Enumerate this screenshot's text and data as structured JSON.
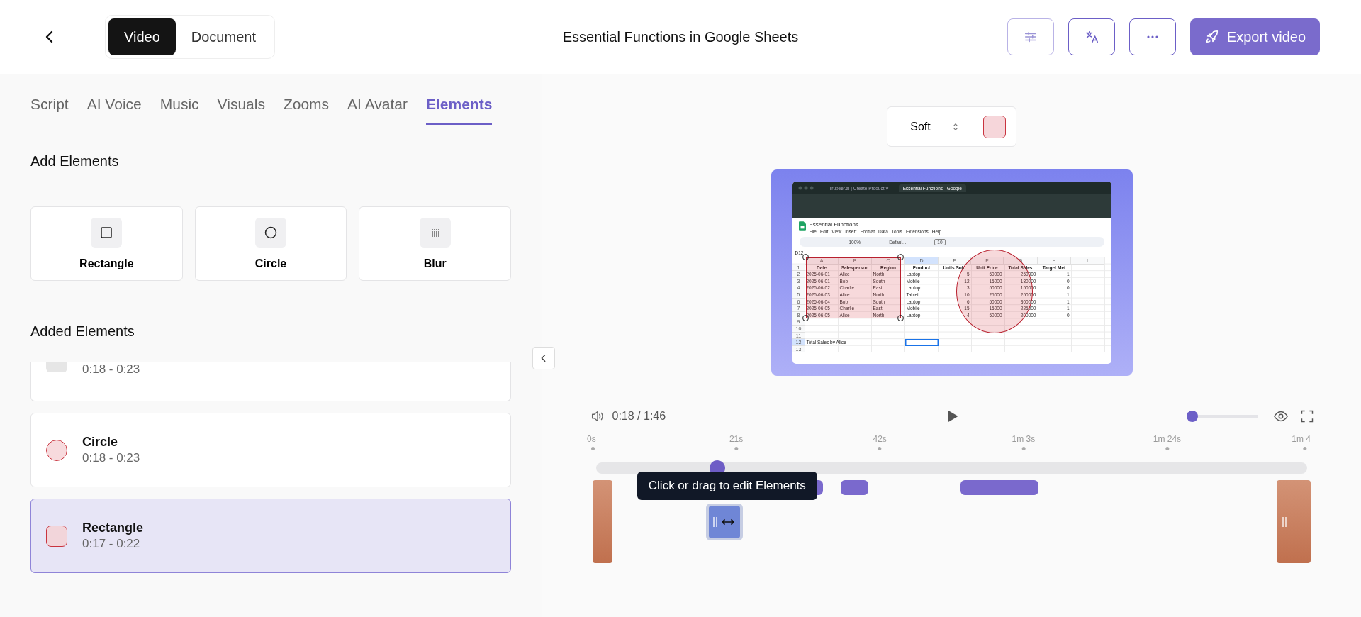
{
  "header": {
    "mode_tabs": [
      {
        "label": "Video",
        "selected": true
      },
      {
        "label": "Document",
        "selected": false
      }
    ],
    "title": "Essential Functions in Google Sheets",
    "export_button": "Export video"
  },
  "panel_tabs": [
    {
      "label": "Script",
      "selected": false
    },
    {
      "label": "AI Voice",
      "selected": false
    },
    {
      "label": "Music",
      "selected": false
    },
    {
      "label": "Visuals",
      "selected": false
    },
    {
      "label": "Zooms",
      "selected": false
    },
    {
      "label": "AI Avatar",
      "selected": false
    },
    {
      "label": "Elements",
      "selected": true
    }
  ],
  "add_elements": {
    "heading": "Add Elements",
    "items": [
      {
        "label": "Rectangle",
        "kind": "rectangle"
      },
      {
        "label": "Circle",
        "kind": "circle"
      },
      {
        "label": "Blur",
        "kind": "blur"
      }
    ]
  },
  "added_elements": {
    "heading": "Added Elements",
    "items": [
      {
        "kind": "blur",
        "time": "0:18 - 0:23",
        "selected": false
      },
      {
        "kind": "circle",
        "name": "Circle",
        "time": "0:18 - 0:23",
        "selected": false
      },
      {
        "kind": "rectangle",
        "name": "Rectangle",
        "time": "0:17 - 0:22",
        "selected": true
      }
    ]
  },
  "style_picker": {
    "value": "Soft"
  },
  "preview": {
    "browser_tabs": [
      {
        "title": "Trupeer.ai | Create Product V",
        "selected": false
      },
      {
        "title": "Essential Functions - Google",
        "selected": true
      }
    ],
    "doc_title": "Essential Functions",
    "menu": [
      "File",
      "Edit",
      "View",
      "Insert",
      "Format",
      "Data",
      "Tools",
      "Extensions",
      "Help"
    ],
    "toolbar": {
      "zoom": "100%",
      "font": "Defaul...",
      "size": "10"
    },
    "name_box": "D12",
    "columns": [
      "A",
      "B",
      "C",
      "D",
      "E",
      "F",
      "G",
      "H",
      "I"
    ],
    "rows": [
      {
        "num": "1",
        "cells": [
          "Date",
          "Salesperson",
          "Region",
          "Product",
          "Units Sold",
          "Unit Price",
          "Total Sales",
          "Target Met",
          null
        ]
      },
      {
        "num": "2",
        "cells": [
          "2025-06-01",
          "Alice",
          "North",
          "Laptop",
          "5",
          "50000",
          "250000",
          "1",
          null
        ]
      },
      {
        "num": "3",
        "cells": [
          "2025-06-01",
          "Bob",
          "South",
          "Mobile",
          "12",
          "15000",
          "180000",
          "0",
          null
        ]
      },
      {
        "num": "4",
        "cells": [
          "2025-06-02",
          "Charlie",
          "East",
          "Laptop",
          "3",
          "50000",
          "150000",
          "0",
          null
        ]
      },
      {
        "num": "5",
        "cells": [
          "2025-06-03",
          "Alice",
          "North",
          "Tablet",
          "10",
          "25000",
          "250000",
          "1",
          null
        ]
      },
      {
        "num": "6",
        "cells": [
          "2025-06-04",
          "Bob",
          "South",
          "Laptop",
          "6",
          "50000",
          "300000",
          "1",
          null
        ]
      },
      {
        "num": "7",
        "cells": [
          "2025-06-05",
          "Charlie",
          "East",
          "Mobile",
          "15",
          "15000",
          "225000",
          "1",
          null
        ]
      },
      {
        "num": "8",
        "cells": [
          "2025-06-05",
          "Alice",
          "North",
          "Laptop",
          "4",
          "50000",
          "200000",
          "0",
          null
        ]
      },
      {
        "num": "9",
        "cells": [
          null,
          null,
          null,
          null,
          null,
          null,
          null,
          null,
          null
        ]
      },
      {
        "num": "10",
        "cells": [
          null,
          null,
          null,
          null,
          null,
          null,
          null,
          null,
          null
        ]
      },
      {
        "num": "11",
        "cells": [
          null,
          null,
          null,
          null,
          null,
          null,
          null,
          null,
          null
        ]
      },
      {
        "num": "12",
        "cells": [
          "Total Sales by Alice",
          null,
          null,
          null,
          null,
          null,
          null,
          null,
          null
        ]
      },
      {
        "num": "13",
        "cells": [
          null,
          null,
          null,
          null,
          null,
          null,
          null,
          null,
          null
        ]
      }
    ]
  },
  "player": {
    "time": "0:18 / 1:46",
    "volume": {
      "level": 0
    }
  },
  "timeline": {
    "ticks": [
      "0s",
      "21s",
      "42s",
      "1m 3s",
      "1m 24s",
      "1m 4"
    ],
    "playhead": {
      "level": 0.17
    },
    "tooltip": "Click or drag to edit Elements"
  }
}
